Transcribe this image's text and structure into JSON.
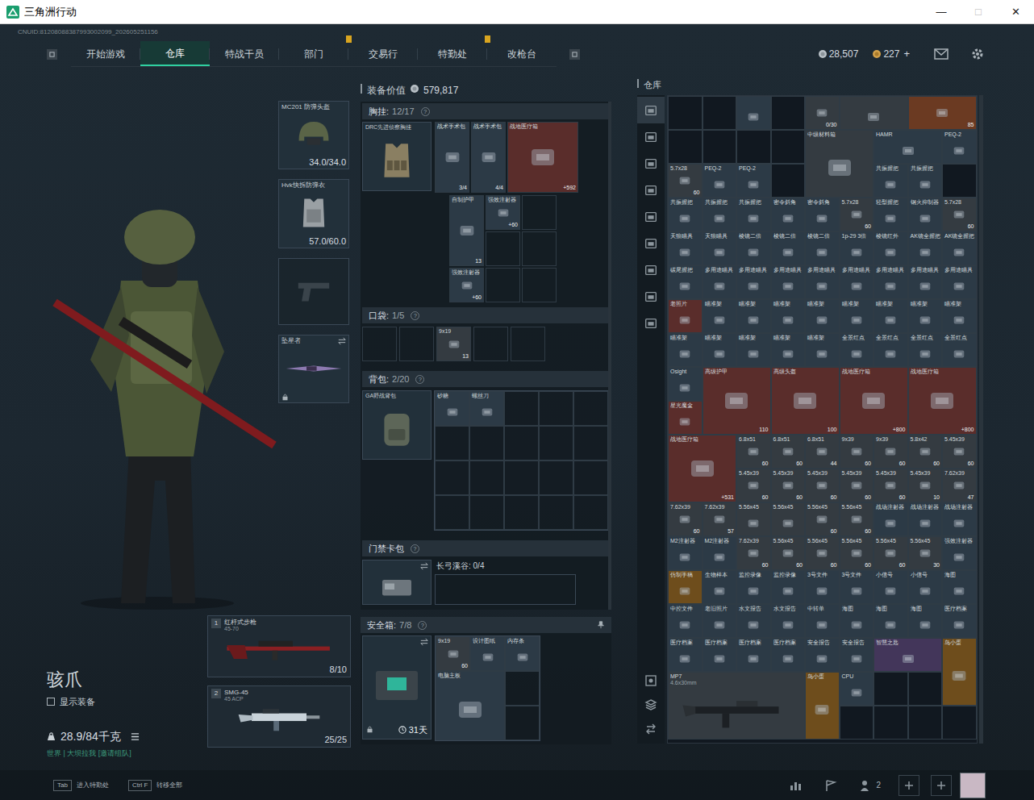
{
  "window": {
    "title": "三角洲行动",
    "controls": [
      {
        "label": "—",
        "disabled": false
      },
      {
        "label": "□",
        "disabled": true
      },
      {
        "label": "✕",
        "disabled": false
      }
    ]
  },
  "uid": "CNUID:81208088387993002099_202605251156",
  "nav": {
    "tabs": [
      {
        "label": "开始游戏",
        "selected": false,
        "alert": false
      },
      {
        "label": "仓库",
        "selected": true,
        "alert": false
      },
      {
        "label": "特战干员",
        "selected": false,
        "alert": false
      },
      {
        "label": "部门",
        "selected": false,
        "alert": true
      },
      {
        "label": "交易行",
        "selected": false,
        "alert": false
      },
      {
        "label": "特勤处",
        "selected": false,
        "alert": true
      },
      {
        "label": "改枪台",
        "selected": false,
        "alert": false
      }
    ]
  },
  "currency": {
    "silver": "28,507",
    "gold": "227",
    "add": "+"
  },
  "operator": {
    "name": "骇爪",
    "show_gear": {
      "label": "显示装备",
      "checked": false
    },
    "weight": "28.9/84千克",
    "chat": "世界 | 大坝拉我 [邀请组队]"
  },
  "gear_slots": [
    {
      "kind": "helmet",
      "name": "MC201 防弹头盔",
      "durability": "34.0/34.0",
      "swappable": false,
      "locked": false
    },
    {
      "kind": "armor",
      "name": "Hvk快拆防弹衣",
      "durability": "57.0/60.0",
      "swappable": false,
      "locked": false
    },
    {
      "kind": "pistol",
      "swappable": false,
      "locked": false
    },
    {
      "kind": "melee",
      "name": "坠星者",
      "swappable": true,
      "locked": true
    }
  ],
  "weapons": [
    {
      "slot": "1",
      "kind": "rifle",
      "name": "红杆式步枪",
      "caliber": "45-70",
      "ammo": "8/10"
    },
    {
      "slot": "2",
      "kind": "smg",
      "name": "SMG-45",
      "caliber": "45 ACP",
      "ammo": "25/25"
    }
  ],
  "loadout": {
    "value_label": "装备价值",
    "value": "579,817",
    "rig": {
      "title": "胸挂:",
      "count": "12/17",
      "help": "?",
      "item": "DRC先进侦察胸挂",
      "top": [
        {
          "label": "战术手术包",
          "count": "3/4",
          "kind": "tall",
          "color": "#2c3a46"
        },
        {
          "label": "战术手术包",
          "count": "4/4",
          "kind": "tall",
          "color": "#2c3a46"
        },
        {
          "label": "战地医疗箱",
          "count": "+592",
          "kind": "large",
          "color": "#5a2d2b"
        }
      ],
      "slots": [
        {
          "label": "自制护甲",
          "count": "13",
          "kind": "tall",
          "color": "#2c3a46"
        },
        {
          "label": "强效注射器",
          "count": "+60",
          "kind": "small",
          "color": "#2c3a46"
        },
        {
          "kind": "empty"
        },
        {
          "kind": "empty"
        },
        {
          "kind": "empty"
        },
        {
          "label": "强效注射器",
          "count": "+60",
          "kind": "small",
          "color": "#2c3a46"
        },
        {
          "kind": "empty"
        },
        {
          "kind": "empty"
        }
      ]
    },
    "pockets": {
      "title": "口袋:",
      "count": "1/5",
      "help": "?",
      "slots": [
        {
          "kind": "empty"
        },
        {
          "kind": "empty"
        },
        {
          "label": "9x19",
          "count": "13",
          "kind": "small",
          "color": "#343b41"
        },
        {
          "kind": "empty"
        },
        {
          "kind": "empty"
        }
      ]
    },
    "backpack": {
      "title": "背包:",
      "count": "2/20",
      "help": "?",
      "item": "GA野战背包",
      "slots": [
        {
          "label": "砂糖",
          "kind": "small",
          "color": "#2c3a46"
        },
        {
          "label": "螺丝刀",
          "kind": "small",
          "color": "#2c3a46"
        },
        {
          "kind": "empty"
        },
        {
          "kind": "empty"
        },
        {
          "kind": "empty"
        },
        {
          "kind": "empty"
        },
        {
          "kind": "empty"
        },
        {
          "kind": "empty"
        },
        {
          "kind": "empty"
        },
        {
          "kind": "empty"
        },
        {
          "kind": "empty"
        },
        {
          "kind": "empty"
        },
        {
          "kind": "empty"
        },
        {
          "kind": "empty"
        },
        {
          "kind": "empty"
        },
        {
          "kind": "empty"
        },
        {
          "kind": "empty"
        },
        {
          "kind": "empty"
        },
        {
          "kind": "empty"
        },
        {
          "kind": "empty"
        }
      ]
    },
    "keycard": {
      "title": "门禁卡包",
      "help": "?",
      "map": "长弓溪谷: 0/4"
    },
    "safe": {
      "title": "安全箱:",
      "count": "7/8",
      "help": "?",
      "timer": "31天",
      "slots": [
        {
          "label": "9x19",
          "count": "60",
          "kind": "small",
          "color": "#343b41"
        },
        {
          "label": "设计图纸",
          "kind": "small",
          "color": "#2c3a46"
        },
        {
          "label": "内存条",
          "kind": "small",
          "color": "#2c3a46"
        },
        {
          "label": "电脑主板",
          "kind": "large",
          "color": "#2c3a46"
        },
        {
          "kind": "empty"
        },
        {
          "kind": "empty"
        }
      ]
    }
  },
  "warehouse": {
    "title": "仓库",
    "categories": [
      {
        "selected": true
      },
      {
        "selected": false
      },
      {
        "selected": false
      },
      {
        "selected": false
      },
      {
        "selected": false
      },
      {
        "selected": false
      },
      {
        "selected": false
      },
      {
        "selected": false
      },
      {
        "selected": false
      }
    ],
    "items": [
      {
        "kind": "empty"
      },
      {
        "kind": "empty"
      },
      {
        "kind": "small",
        "color": "#2c3a46"
      },
      {
        "kind": "empty"
      },
      {
        "count": "0/30",
        "kind": "small",
        "color": "#343b41"
      },
      {
        "kind": "wide",
        "color": "#343b41"
      },
      {
        "count": "85",
        "kind": "wide",
        "color": "#6b3a22"
      },
      {
        "kind": "empty"
      },
      {
        "kind": "empty"
      },
      {
        "kind": "empty"
      },
      {
        "kind": "empty"
      },
      {
        "label": "中级材料箱",
        "kind": "large",
        "color": "#343b41"
      },
      {
        "label": "HAMR",
        "kind": "wide",
        "color": "#2c3a46"
      },
      {
        "label": "PEQ-2",
        "kind": "small",
        "color": "#2c3a46"
      },
      {
        "label": "5.7x28",
        "count": "60",
        "kind": "small",
        "color": "#343b41"
      },
      {
        "label": "PEQ-2",
        "kind": "small",
        "color": "#2c3a46"
      },
      {
        "label": "PEQ-2",
        "kind": "small",
        "color": "#2c3a46"
      },
      {
        "kind": "empty"
      },
      {
        "label": "共振握把",
        "kind": "small",
        "color": "#2c3a46"
      },
      {
        "label": "共振握把",
        "kind": "small",
        "color": "#2c3a46"
      },
      {
        "kind": "empty"
      },
      {
        "label": "共振握把",
        "kind": "small",
        "color": "#2c3a46"
      },
      {
        "label": "共振握把",
        "kind": "small",
        "color": "#2c3a46"
      },
      {
        "label": "共振握把",
        "kind": "small",
        "color": "#2c3a46"
      },
      {
        "label": "密令斜角",
        "kind": "small",
        "color": "#2c3a46"
      },
      {
        "label": "密令斜角",
        "kind": "small",
        "color": "#2c3a46"
      },
      {
        "label": "5.7x28",
        "count": "60",
        "kind": "small",
        "color": "#343b41"
      },
      {
        "label": "轻型握把",
        "kind": "small",
        "color": "#2c3a46"
      },
      {
        "label": "钢火抑制器",
        "kind": "small",
        "color": "#2c3a46"
      },
      {
        "label": "5.7x28",
        "count": "60",
        "kind": "small",
        "color": "#343b41"
      },
      {
        "label": "天狼瞄具",
        "kind": "small",
        "color": "#2c3a46"
      },
      {
        "label": "天狼瞄具",
        "kind": "small",
        "color": "#2c3a46"
      },
      {
        "label": "棱镜二倍",
        "kind": "small",
        "color": "#2c3a46"
      },
      {
        "label": "棱镜二倍",
        "kind": "small",
        "color": "#2c3a46"
      },
      {
        "label": "棱镜二倍",
        "kind": "small",
        "color": "#2c3a46"
      },
      {
        "label": "1p-29 3倍",
        "kind": "small",
        "color": "#2c3a46"
      },
      {
        "label": "棱镜红外",
        "kind": "small",
        "color": "#2c3a46"
      },
      {
        "label": "AK镜全握把",
        "kind": "small",
        "color": "#2c3a46"
      },
      {
        "label": "AK镜全握把",
        "kind": "small",
        "color": "#2c3a46"
      },
      {
        "label": "碳尾握把",
        "kind": "small",
        "color": "#2c3a46"
      },
      {
        "label": "多用途瞄具",
        "kind": "small",
        "color": "#2c3a46"
      },
      {
        "label": "多用途瞄具",
        "kind": "small",
        "color": "#2c3a46"
      },
      {
        "label": "多用途瞄具",
        "kind": "small",
        "color": "#2c3a46"
      },
      {
        "label": "多用途瞄具",
        "kind": "small",
        "color": "#2c3a46"
      },
      {
        "label": "多用途瞄具",
        "kind": "small",
        "color": "#2c3a46"
      },
      {
        "label": "多用途瞄具",
        "kind": "small",
        "color": "#2c3a46"
      },
      {
        "label": "多用途瞄具",
        "kind": "small",
        "color": "#2c3a46"
      },
      {
        "label": "多用途瞄具",
        "kind": "small",
        "color": "#2c3a46"
      },
      {
        "label": "老照片",
        "kind": "small",
        "color": "#5a2d2b"
      },
      {
        "label": "瞄准架",
        "kind": "small",
        "color": "#2c3a46"
      },
      {
        "label": "瞄准架",
        "kind": "small",
        "color": "#2c3a46"
      },
      {
        "label": "瞄准架",
        "kind": "small",
        "color": "#2c3a46"
      },
      {
        "label": "瞄准架",
        "kind": "small",
        "color": "#2c3a46"
      },
      {
        "label": "瞄准架",
        "kind": "small",
        "color": "#2c3a46"
      },
      {
        "label": "瞄准架",
        "kind": "small",
        "color": "#2c3a46"
      },
      {
        "label": "瞄准架",
        "kind": "small",
        "color": "#2c3a46"
      },
      {
        "label": "瞄准架",
        "kind": "small",
        "color": "#2c3a46"
      },
      {
        "label": "瞄准架",
        "kind": "small",
        "color": "#2c3a46"
      },
      {
        "label": "瞄准架",
        "kind": "small",
        "color": "#2c3a46"
      },
      {
        "label": "瞄准架",
        "kind": "small",
        "color": "#2c3a46"
      },
      {
        "label": "瞄准架",
        "kind": "small",
        "color": "#2c3a46"
      },
      {
        "label": "瞄准架",
        "kind": "small",
        "color": "#2c3a46"
      },
      {
        "label": "全景红点",
        "kind": "small",
        "color": "#2c3a46"
      },
      {
        "label": "全景红点",
        "kind": "small",
        "color": "#2c3a46"
      },
      {
        "label": "全景红点",
        "kind": "small",
        "color": "#2c3a46"
      },
      {
        "label": "全景红点",
        "kind": "small",
        "color": "#2c3a46"
      },
      {
        "label": "Osight",
        "kind": "small",
        "color": "#2c3a46"
      },
      {
        "label": "高级护甲",
        "count": "110",
        "kind": "large",
        "color": "#5a2d2b"
      },
      {
        "label": "高级头盔",
        "count": "100",
        "kind": "large",
        "color": "#5a2d2b"
      },
      {
        "label": "战地医疗箱",
        "count": "+800",
        "kind": "large",
        "color": "#5a2d2b"
      },
      {
        "label": "战地医疗箱",
        "count": "+800",
        "kind": "large",
        "color": "#5a2d2b"
      },
      {
        "label": "星光魔盒",
        "kind": "small",
        "color": "#5a2d2b"
      },
      {
        "label": "战地医疗箱",
        "count": "+531",
        "kind": "large",
        "color": "#5a2d2b"
      },
      {
        "label": "6.8x51",
        "count": "60",
        "kind": "small",
        "color": "#343b41"
      },
      {
        "label": "6.8x51",
        "count": "60",
        "kind": "small",
        "color": "#343b41"
      },
      {
        "label": "6.8x51",
        "count": "44",
        "kind": "small",
        "color": "#343b41"
      },
      {
        "label": "9x39",
        "count": "60",
        "kind": "small",
        "color": "#343b41"
      },
      {
        "label": "9x39",
        "count": "60",
        "kind": "small",
        "color": "#343b41"
      },
      {
        "label": "5.8x42",
        "count": "60",
        "kind": "small",
        "color": "#343b41"
      },
      {
        "label": "5.45x39",
        "count": "60",
        "kind": "small",
        "color": "#343b41"
      },
      {
        "label": "5.45x39",
        "count": "60",
        "kind": "small",
        "color": "#343b41"
      },
      {
        "label": "5.45x39",
        "count": "60",
        "kind": "small",
        "color": "#343b41"
      },
      {
        "label": "5.45x39",
        "count": "60",
        "kind": "small",
        "color": "#343b41"
      },
      {
        "label": "5.45x39",
        "count": "60",
        "kind": "small",
        "color": "#343b41"
      },
      {
        "label": "5.45x39",
        "count": "60",
        "kind": "small",
        "color": "#343b41"
      },
      {
        "label": "5.45x39",
        "count": "10",
        "kind": "small",
        "color": "#343b41"
      },
      {
        "label": "7.62x39",
        "count": "47",
        "kind": "small",
        "color": "#343b41"
      },
      {
        "label": "7.62x39",
        "count": "60",
        "kind": "small",
        "color": "#343b41"
      },
      {
        "label": "7.62x39",
        "count": "57",
        "kind": "small",
        "color": "#343b41"
      },
      {
        "label": "5.56x45",
        "kind": "small",
        "color": "#343b41"
      },
      {
        "label": "5.56x45",
        "kind": "small",
        "color": "#343b41"
      },
      {
        "label": "5.56x45",
        "count": "60",
        "kind": "small",
        "color": "#343b41"
      },
      {
        "label": "5.56x45",
        "count": "60",
        "kind": "small",
        "color": "#343b41"
      },
      {
        "label": "战场注射器",
        "kind": "small",
        "color": "#2c3a46"
      },
      {
        "label": "战场注射器",
        "kind": "small",
        "color": "#2c3a46"
      },
      {
        "label": "战场注射器",
        "kind": "small",
        "color": "#2c3a46"
      },
      {
        "label": "M2注射器",
        "kind": "small",
        "color": "#2c3a46"
      },
      {
        "label": "M2注射器",
        "kind": "small",
        "color": "#2c3a46"
      },
      {
        "label": "7.62x39",
        "count": "60",
        "kind": "small",
        "color": "#343b41"
      },
      {
        "label": "5.56x45",
        "count": "60",
        "kind": "small",
        "color": "#343b41"
      },
      {
        "label": "5.56x45",
        "count": "60",
        "kind": "small",
        "color": "#343b41"
      },
      {
        "label": "5.56x45",
        "count": "60",
        "kind": "small",
        "color": "#343b41"
      },
      {
        "label": "5.56x45",
        "count": "60",
        "kind": "small",
        "color": "#343b41"
      },
      {
        "label": "5.56x45",
        "count": "30",
        "kind": "small",
        "color": "#343b41"
      },
      {
        "label": "强效注射器",
        "kind": "small",
        "color": "#2c3a46"
      },
      {
        "label": "仿制手稿",
        "kind": "small",
        "color": "#6e4d1c"
      },
      {
        "label": "生物样本",
        "kind": "small",
        "color": "#2c3a46"
      },
      {
        "label": "监控录像",
        "kind": "small",
        "color": "#2c3a46"
      },
      {
        "label": "监控录像",
        "kind": "small",
        "color": "#2c3a46"
      },
      {
        "label": "3号文件",
        "kind": "small",
        "color": "#2c3a46"
      },
      {
        "label": "3号文件",
        "kind": "small",
        "color": "#2c3a46"
      },
      {
        "label": "小信号",
        "kind": "small",
        "color": "#2c3a46"
      },
      {
        "label": "小信号",
        "kind": "small",
        "color": "#2c3a46"
      },
      {
        "label": "海图",
        "kind": "small",
        "color": "#2c3a46"
      },
      {
        "label": "中控文件",
        "kind": "small",
        "color": "#2c3a46"
      },
      {
        "label": "老旧照片",
        "kind": "small",
        "color": "#2c3a46"
      },
      {
        "label": "水文报告",
        "kind": "small",
        "color": "#2c3a46"
      },
      {
        "label": "水文报告",
        "kind": "small",
        "color": "#2c3a46"
      },
      {
        "label": "中转单",
        "kind": "small",
        "color": "#2c3a46"
      },
      {
        "label": "海图",
        "kind": "small",
        "color": "#2c3a46"
      },
      {
        "label": "海图",
        "kind": "small",
        "color": "#2c3a46"
      },
      {
        "label": "海图",
        "kind": "small",
        "color": "#2c3a46"
      },
      {
        "label": "医疗档案",
        "kind": "small",
        "color": "#2c3a46"
      },
      {
        "label": "医疗档案",
        "kind": "small",
        "color": "#2c3a46"
      },
      {
        "label": "医疗档案",
        "kind": "small",
        "color": "#2c3a46"
      },
      {
        "label": "医疗档案",
        "kind": "small",
        "color": "#2c3a46"
      },
      {
        "label": "医疗档案",
        "kind": "small",
        "color": "#2c3a46"
      },
      {
        "label": "安全报告",
        "kind": "small",
        "color": "#2c3a46"
      },
      {
        "label": "安全报告",
        "kind": "small",
        "color": "#2c3a46"
      },
      {
        "label": "智慧之匙",
        "kind": "wide",
        "color": "#43365a"
      },
      {
        "label": "鸟小蛋",
        "kind": "tall",
        "color": "#6e4d1c"
      },
      {
        "label": "MP7",
        "caliber": "4.6x30mm",
        "kind": "gun",
        "color": "#343b41"
      },
      {
        "label": "鸟小蛋",
        "kind": "tall",
        "color": "#6e4d1c"
      },
      {
        "label": "CPU",
        "kind": "small",
        "color": "#2c3a46"
      },
      {
        "kind": "empty"
      },
      {
        "kind": "empty"
      },
      {
        "kind": "empty"
      },
      {
        "kind": "empty"
      },
      {
        "kind": "empty"
      },
      {
        "kind": "empty"
      }
    ]
  },
  "footer": {
    "hints": [
      {
        "key": "Tab",
        "label": "进入特勤处"
      },
      {
        "key": "Ctrl F",
        "label": "转移全部"
      }
    ],
    "team_count": "2"
  }
}
